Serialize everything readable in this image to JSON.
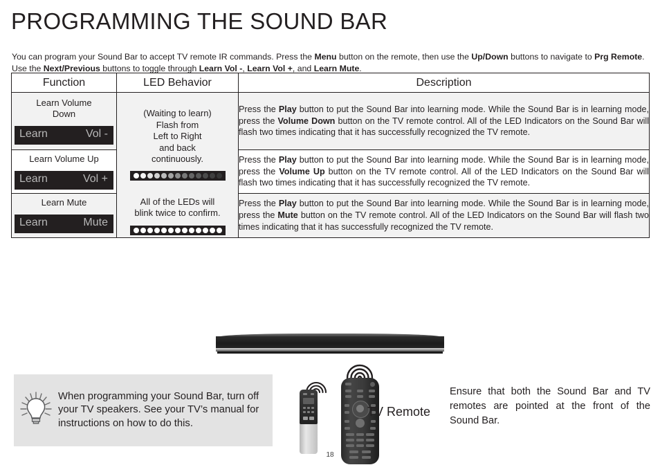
{
  "page": {
    "title": "PROGRAMMING THE SOUND BAR",
    "number": "18"
  },
  "intro": {
    "p1a": "You can program your Sound Bar to accept TV remote IR commands. Press the ",
    "b1": "Menu",
    "p1b": " button on the remote, then use the ",
    "b2": "Up/Down",
    "p2a": " buttons to navigate to ",
    "b3": "Prg Remote",
    "p2b": ". Use the ",
    "b4": "Next/Previous",
    "p2c": " buttons to toggle through ",
    "b5": "Learn Vol -",
    "p2d": ", ",
    "b6": "Learn Vol +",
    "p2e": ", and ",
    "b7": "Learn Mute",
    "p2f": "."
  },
  "table": {
    "headers": {
      "function": "Function",
      "led_behavior": "LED Behavior",
      "description": "Description"
    },
    "rows": [
      {
        "function_name": "Learn Volume Down",
        "function_name_line1": "Learn Volume",
        "function_name_line2": "Down",
        "lcd_left": "Learn",
        "lcd_right": "Vol -",
        "desc": {
          "a": "Press the ",
          "b1": "Play",
          "b": " button to put the Sound Bar into learning mode. While the Sound Bar is in learning mode, press the ",
          "b2": "Volume Down",
          "c": " button on the TV remote control. All of the LED Indicators on the Sound Bar will flash two times indicating that it has successfully recognized the TV remote."
        }
      },
      {
        "function_name": "Learn Volume Up",
        "function_name_line1": "Learn Volume Up",
        "function_name_line2": "",
        "lcd_left": "Learn",
        "lcd_right": "Vol +",
        "desc": {
          "a": "Press the ",
          "b1": "Play",
          "b": " button to put the Sound Bar into learning mode. While the Sound Bar is in learning mode, press the ",
          "b2": "Volume Up",
          "c": " button on the TV remote control. All of the LED Indicators on the Sound Bar will flash two times indicating that it has successfully recognized the TV remote."
        }
      },
      {
        "function_name": "Learn Mute",
        "function_name_line1": "Learn Mute",
        "function_name_line2": "",
        "lcd_left": "Learn",
        "lcd_right": "Mute",
        "desc": {
          "a": "Press the ",
          "b1": "Play",
          "b": " button to put the Sound Bar into learning mode. While the Sound Bar is in learning mode, press the ",
          "b2": "Mute",
          "c": " button on the TV remote control. All of the LED Indicators on the Sound Bar will flash two times indicating that it has successfully recognized the TV remote."
        }
      }
    ],
    "led_behavior": {
      "line1": "(Waiting to learn)",
      "line2": "Flash from",
      "line3": "Left to Right",
      "line4": "and back",
      "line5": "continuously.",
      "line6": "All of the LEDs will",
      "line7": "blink twice to confirm.",
      "strip_gradient_colors": [
        "#ffffff",
        "#f4f4f4",
        "#e4e4e4",
        "#d2d2d2",
        "#bcbcbc",
        "#a3a3a3",
        "#8c8c8c",
        "#787878",
        "#666666",
        "#585858",
        "#4b4b4b",
        "#3f3f3f",
        "#363636"
      ],
      "strip_solid_color": "#ffffff",
      "strip_led_count": 13,
      "strip_background": "#231f20"
    }
  },
  "tip": {
    "icon": "lightbulb-icon",
    "text": "When programming your Sound Bar, turn off your TV speakers. See your TV’s manual for instructions on how to do this."
  },
  "illustration": {
    "soundbar_alt": "sound-bar",
    "sb_remote_alt": "sound-bar-remote",
    "tv_remote_alt": "tv-remote",
    "tv_remote_label": "TV Remote"
  },
  "right_note": {
    "text": "Ensure that  both the Sound  Bar and TV remotes are pointed at the front of the Sound Bar."
  },
  "colors": {
    "ink": "#231f20",
    "row_shade": "#f2f2f2",
    "tip_bg": "#e3e3e3",
    "lcd_bg": "#231f20",
    "lcd_text": "#b8b8b8"
  }
}
